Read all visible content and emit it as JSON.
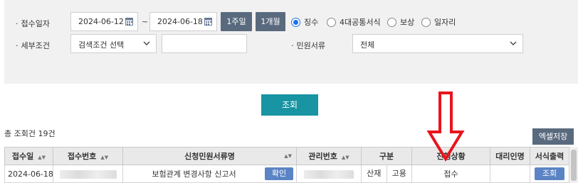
{
  "filters": {
    "receipt_date_label": "접수일자",
    "date_from": "2024-06-12",
    "date_to": "2024-06-18",
    "tilde": "~",
    "week_button": "1주일",
    "month_button": "1개월",
    "radios": [
      {
        "label": "징수",
        "selected": true
      },
      {
        "label": "4대공통서식",
        "selected": false
      },
      {
        "label": "보상",
        "selected": false
      },
      {
        "label": "일자리",
        "selected": false
      }
    ],
    "detail_label": "세부조건",
    "detail_select": "검색조건 선택",
    "detail_input_value": "",
    "doc_label": "민원서류",
    "doc_select": "전체"
  },
  "search_button": "조회",
  "result_count": "총 조회건 19건",
  "excel_button": "엑셀저장",
  "table": {
    "headers": [
      "접수일",
      "접수번호",
      "신청민원서류명",
      "관리번호",
      "구분",
      "진행상황",
      "대리인명",
      "서식출력"
    ],
    "rows": [
      {
        "date": "2024-06-18",
        "doc_name": "보험관계 변경사항 신고서",
        "confirm": "확인",
        "type1": "산재",
        "type2": "고용",
        "status": "접수",
        "agent": "",
        "print": "조회"
      }
    ]
  },
  "colors": {
    "accent": "#1894a3",
    "button": "#5a6a7e",
    "row_button": "#5b84c4",
    "annotation": "#e8141c"
  }
}
